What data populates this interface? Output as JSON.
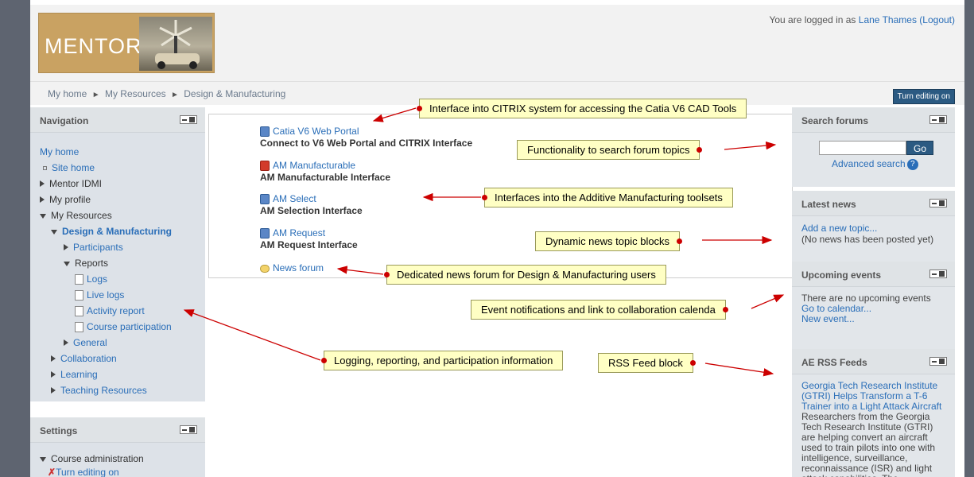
{
  "header": {
    "logo_text": "MENTOR",
    "login_prefix": "You are logged in as",
    "user_name": "Lane Thames",
    "logout": "(Logout)"
  },
  "breadcrumb": [
    "My home",
    "My Resources",
    "Design & Manufacturing"
  ],
  "edit_button": "Turn editing on",
  "navigation": {
    "title": "Navigation",
    "items": [
      {
        "label": "My home"
      },
      {
        "label": "Site home"
      },
      {
        "label": "Mentor IDMI"
      },
      {
        "label": "My profile"
      },
      {
        "label": "My Resources"
      },
      {
        "label": "Design & Manufacturing"
      },
      {
        "label": "Participants"
      },
      {
        "label": "Reports"
      },
      {
        "label": "Logs"
      },
      {
        "label": "Live logs"
      },
      {
        "label": "Activity report"
      },
      {
        "label": "Course participation"
      },
      {
        "label": "General"
      },
      {
        "label": "Collaboration"
      },
      {
        "label": "Learning"
      },
      {
        "label": "Teaching Resources"
      }
    ]
  },
  "settings": {
    "title": "Settings",
    "course_admin": "Course administration",
    "turn_editing": "Turn editing on"
  },
  "activities": [
    {
      "link": "Catia V6 Web Portal",
      "desc": "Connect to V6 Web Portal and CITRIX Interface"
    },
    {
      "link": "AM Manufacturable",
      "desc": "AM Manufacturable Interface"
    },
    {
      "link": "AM Select",
      "desc": "AM Selection Interface"
    },
    {
      "link": "AM Request",
      "desc": "AM Request Interface"
    },
    {
      "link": "News forum",
      "desc": ""
    }
  ],
  "right": {
    "search": {
      "title": "Search forums",
      "go": "Go",
      "advanced": "Advanced search"
    },
    "news": {
      "title": "Latest news",
      "add": "Add a new topic...",
      "none": "(No news has been posted yet)"
    },
    "events": {
      "title": "Upcoming events",
      "none": "There are no upcoming events",
      "calendar": "Go to calendar...",
      "new": "New event..."
    },
    "rss": {
      "title": "AE RSS Feeds",
      "headline": "Georgia Tech Research Institute (GTRI) Helps Transform a T-6 Trainer into a Light Attack Aircraft",
      "body": "Researchers from the Georgia Tech Research Institute (GTRI) are helping convert an aircraft used to train pilots into one with intelligence, surveillance, reconnaissance (ISR) and light attack capabilities. The"
    }
  },
  "callouts": {
    "citrix": "Interface into CITRIX system for accessing the Catia V6 CAD Tools",
    "search": "Functionality to search forum topics",
    "additive": "Interfaces into the Additive Manufacturing toolsets",
    "news_blocks": "Dynamic news topic blocks",
    "news_forum": "Dedicated news forum for Design & Manufacturing users",
    "events": "Event notifications and link to collaboration calenda",
    "logging": "Logging, reporting, and participation information",
    "rss": "RSS Feed block"
  },
  "colors": {
    "link": "#2a6eb8",
    "callout_bg": "#ffffc4",
    "arrow": "#cc0000",
    "button": "#2b5a82"
  }
}
